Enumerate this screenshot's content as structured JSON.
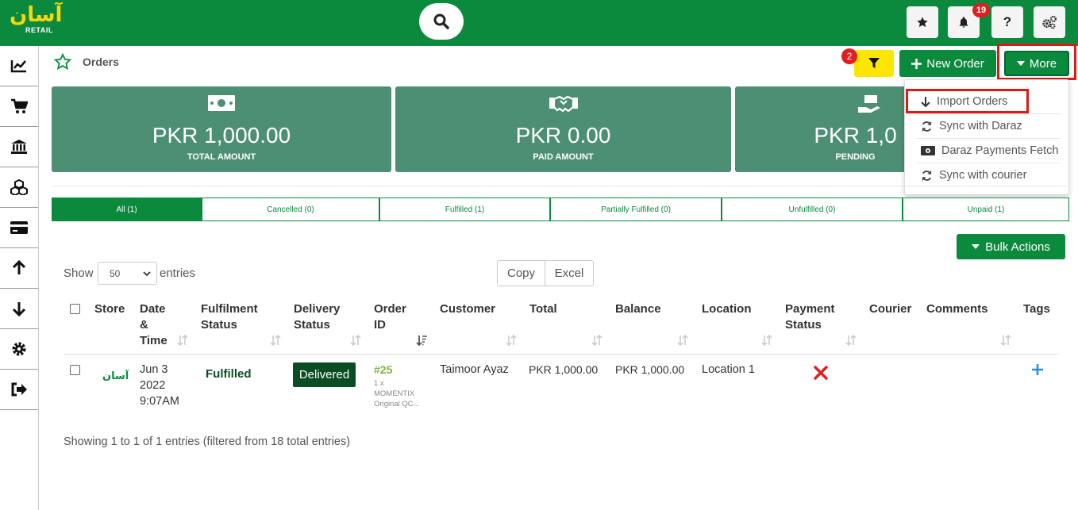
{
  "brand": {
    "logo_text": "آسان",
    "logo_sub": "RETAIL",
    "primary": "#0b8a3e",
    "accent": "#ffe500",
    "card_bg": "#4d8f73"
  },
  "topbar": {
    "search_icon": "search-icon",
    "buttons": [
      "star-icon",
      "bell-icon",
      "question-icon",
      "cogs-icon"
    ],
    "notification_count": "19"
  },
  "sidebar": {
    "items": [
      "chart-line-icon",
      "cart-icon",
      "bank-icon",
      "cubes-icon",
      "credit-card-icon",
      "arrow-up-icon",
      "arrow-down-icon",
      "gear-icon",
      "sign-out-icon"
    ]
  },
  "header": {
    "title": "Orders",
    "filter_count": "2",
    "new_order_label": "New Order",
    "more_label": "More"
  },
  "more_menu": {
    "items": [
      {
        "label": "Import Orders",
        "icon": "arrow-down-icon"
      },
      {
        "label": "Sync with Daraz",
        "icon": "sync-icon"
      },
      {
        "label": "Daraz Payments Fetch",
        "icon": "money-icon"
      },
      {
        "label": "Sync with courier",
        "icon": "sync-icon"
      }
    ]
  },
  "cards": [
    {
      "amount": "PKR 1,000.00",
      "label": "TOTAL AMOUNT",
      "icon": "money-bill-icon"
    },
    {
      "amount": "PKR 0.00",
      "label": "PAID AMOUNT",
      "icon": "handshake-icon"
    },
    {
      "amount": "PKR 1,0",
      "label": "PENDING",
      "icon": "hand-money-icon"
    }
  ],
  "tabs": [
    "All (1)",
    "Cancelled (0)",
    "Fulfilled (1)",
    "Partially Fulfilled (0)",
    "Unfulfilled (0)",
    "Unpaid (1)"
  ],
  "bulk_actions_label": "Bulk Actions",
  "table_controls": {
    "show": "Show",
    "entries_value": "50",
    "entries": "entries",
    "copy": "Copy",
    "excel": "Excel"
  },
  "columns": {
    "store": "Store",
    "date_1": "Date",
    "date_2": "&",
    "date_3": "Time",
    "fulfilment_1": "Fulfilment",
    "fulfilment_2": "Status",
    "delivery_1": "Delivery",
    "delivery_2": "Status",
    "order_1": "Order",
    "order_2": "ID",
    "customer": "Customer",
    "total": "Total",
    "balance": "Balance",
    "location": "Location",
    "payment_1": "Payment",
    "payment_2": "Status",
    "courier": "Courier",
    "comments": "Comments",
    "tags": "Tags"
  },
  "row": {
    "store_logo": "آسان",
    "date_1": "Jun 3",
    "date_2": "2022",
    "date_3": "9:07AM",
    "fulfilment": "Fulfilled",
    "delivery": "Delivered",
    "order_id": "#25",
    "order_qty": "1 x",
    "order_item_1": "MOMENTIX",
    "order_item_2": "Original QC...",
    "customer": "Taimoor Ayaz",
    "total": "PKR 1,000.00",
    "balance": "PKR 1,000.00",
    "location": "Location 1",
    "payment_icon": "x-mark-icon",
    "tags_icon": "plus-icon"
  },
  "footer_info": "Showing 1 to 1 of 1 entries (filtered from 18 total entries)"
}
